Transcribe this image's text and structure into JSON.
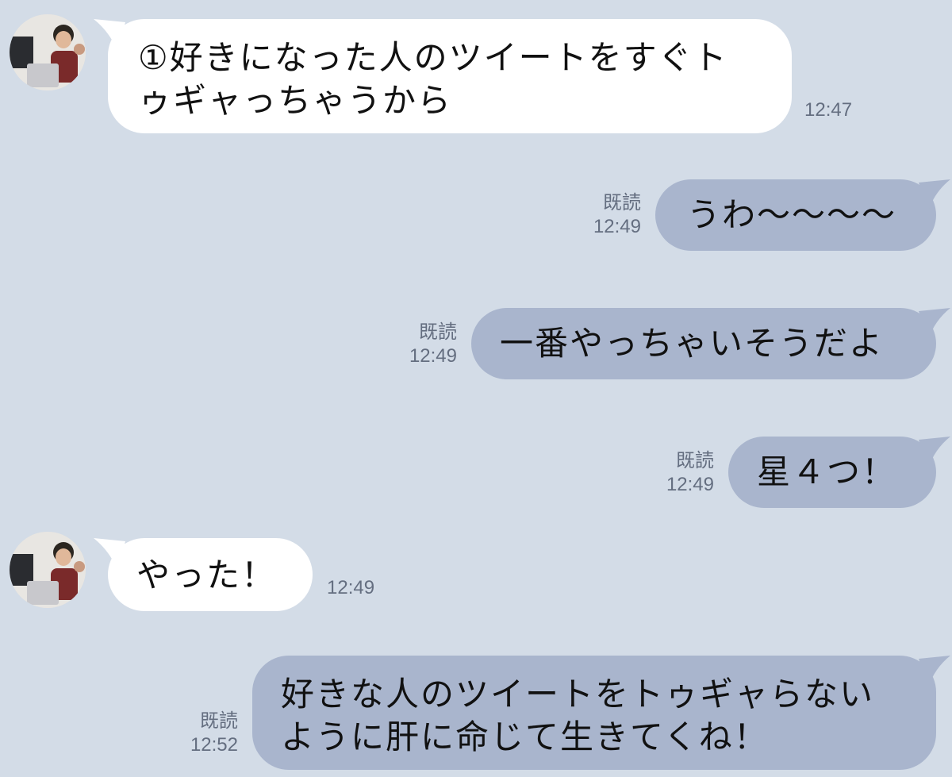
{
  "messages": [
    {
      "side": "in",
      "lines": [
        "①好きになった人のツイートをすぐト",
        "ゥギャっちゃうから"
      ],
      "time": "12:47"
    },
    {
      "side": "out",
      "lines": [
        "うわ〜〜〜〜"
      ],
      "read": "既読",
      "time": "12:49"
    },
    {
      "side": "out",
      "lines": [
        "一番やっちゃいそうだよ"
      ],
      "read": "既読",
      "time": "12:49"
    },
    {
      "side": "out",
      "lines": [
        "星４つ！"
      ],
      "read": "既読",
      "time": "12:49"
    },
    {
      "side": "in",
      "lines": [
        "やった！"
      ],
      "time": "12:49"
    },
    {
      "side": "out",
      "lines": [
        "好きな人のツイートをトゥギャらない",
        "ように肝に命じて生きてくね！"
      ],
      "read": "既読",
      "time": "12:52"
    }
  ],
  "colors": {
    "background": "#d3dce7",
    "incoming_bubble": "#ffffff",
    "outgoing_bubble": "#a9b5cd",
    "meta_text": "#646e80"
  },
  "icons": {
    "avatar": "user-avatar-photo"
  }
}
